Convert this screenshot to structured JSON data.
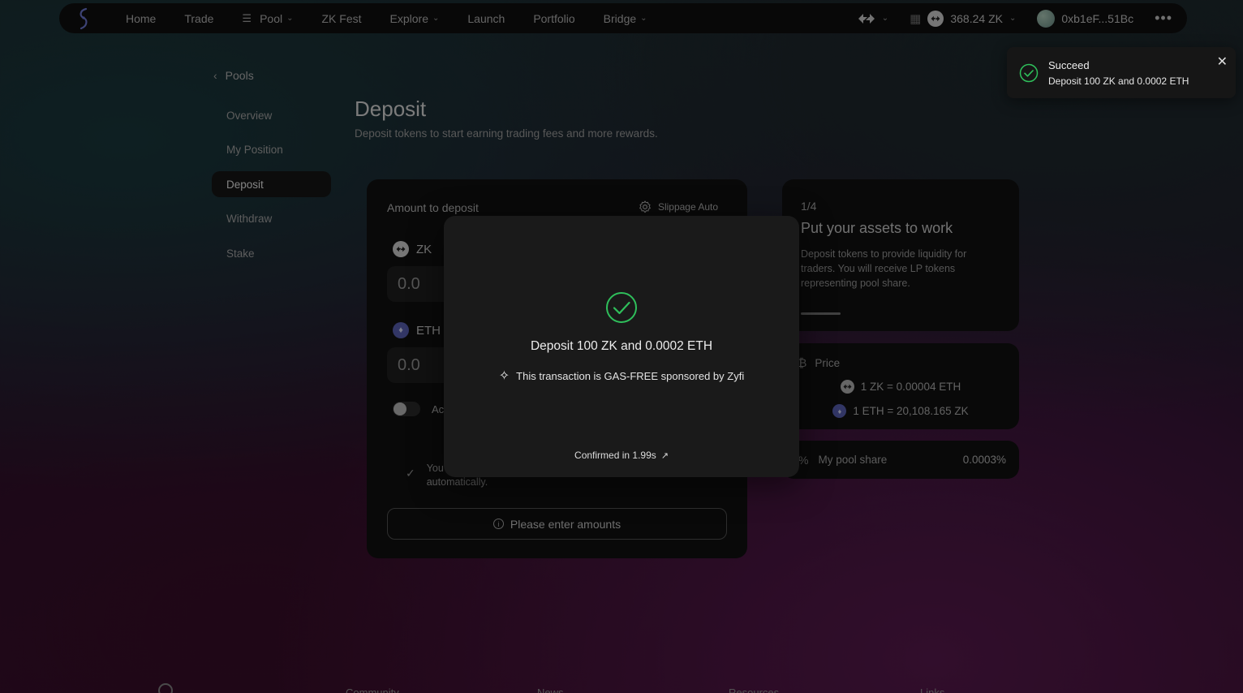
{
  "nav": {
    "items": [
      {
        "label": "Home",
        "dropdown": false
      },
      {
        "label": "Trade",
        "dropdown": false
      },
      {
        "label": "Pool",
        "dropdown": true,
        "icon": "pool-icon"
      },
      {
        "label": "ZK Fest",
        "dropdown": false
      },
      {
        "label": "Explore",
        "dropdown": true
      },
      {
        "label": "Launch",
        "dropdown": false
      },
      {
        "label": "Portfolio",
        "dropdown": false
      },
      {
        "label": "Bridge",
        "dropdown": true
      }
    ],
    "balance": "368.24 ZK",
    "address": "0xb1eF...51Bc"
  },
  "sidebar": {
    "back_label": "Pools",
    "items": [
      {
        "label": "Overview"
      },
      {
        "label": "My Position"
      },
      {
        "label": "Deposit",
        "active": true
      },
      {
        "label": "Withdraw"
      },
      {
        "label": "Stake"
      }
    ]
  },
  "header": {
    "title": "Deposit",
    "subtitle": "Deposit tokens to start earning trading fees and more rewards."
  },
  "deposit": {
    "amount_label": "Amount to deposit",
    "slippage_label": "Slippage Auto",
    "token1": {
      "symbol": "ZK",
      "value": "0.0"
    },
    "token2": {
      "symbol": "ETH",
      "value": "0.0"
    },
    "toggle_label": "Ac",
    "note": "You",
    "note_line2": "automatically.",
    "cta_label": "Please enter amounts"
  },
  "info": {
    "step": "1/4",
    "title": "Put your assets to work",
    "text": "Deposit tokens to provide liquidity for traders. You will receive LP tokens representing pool share.",
    "progress": 0.25
  },
  "price": {
    "label": "Price",
    "line1": "1 ZK = 0.00004 ETH",
    "line2": "1 ETH = 20,108.165 ZK"
  },
  "share": {
    "label": "My pool share",
    "value": "0.0003%"
  },
  "footer": {
    "cols": [
      "Community",
      "News",
      "Resources",
      "Links"
    ]
  },
  "modal": {
    "title": "Deposit 100 ZK and 0.0002 ETH",
    "gas_note": "This transaction is GAS-FREE sponsored by Zyfi",
    "confirmed": "Confirmed in 1.99s"
  },
  "toast": {
    "title": "Succeed",
    "message": "Deposit 100 ZK and 0.0002 ETH"
  },
  "colors": {
    "success": "#2fbf5b",
    "card_bg": "#111111",
    "modal_bg": "#1a1a1a"
  }
}
